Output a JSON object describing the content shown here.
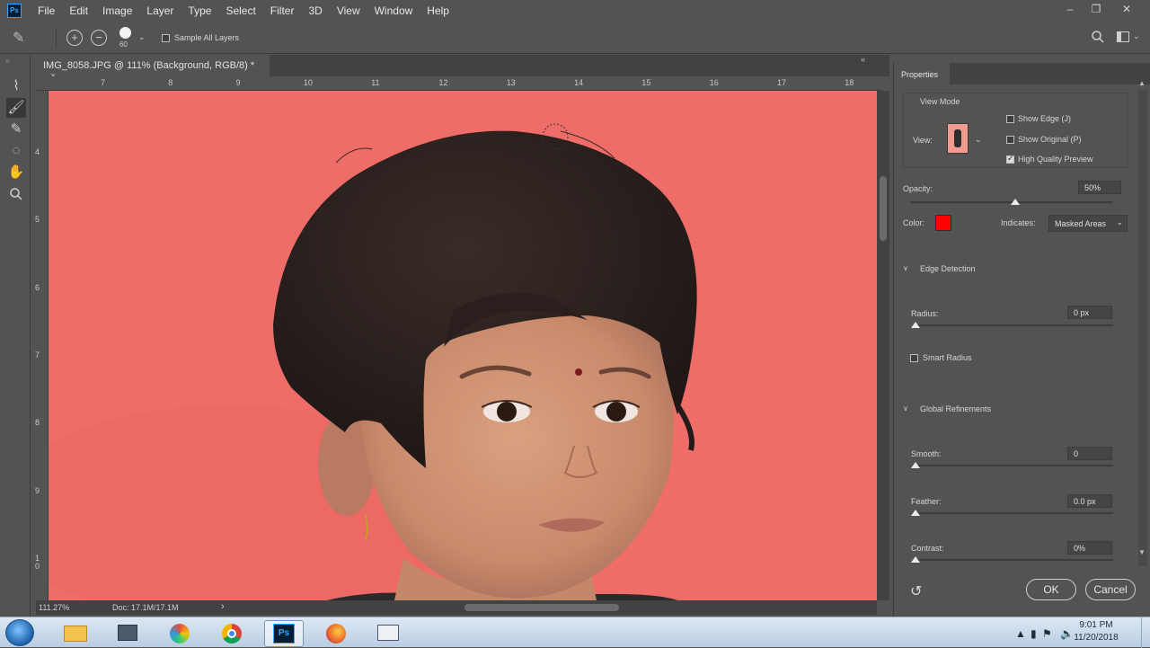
{
  "app": {
    "logo_text": "Ps"
  },
  "menu": [
    "File",
    "Edit",
    "Image",
    "Layer",
    "Type",
    "Select",
    "Filter",
    "3D",
    "View",
    "Window",
    "Help"
  ],
  "options_bar": {
    "brush_size": "60",
    "sample_all_layers_label": "Sample All Layers"
  },
  "document_tab": {
    "title": "IMG_8058.JPG @ 111% (Background, RGB/8) *",
    "close_glyph": "×"
  },
  "ruler": {
    "horizontal": [
      "7",
      "8",
      "9",
      "10",
      "11",
      "12",
      "13",
      "14",
      "15",
      "16",
      "17",
      "18"
    ],
    "vertical": [
      "4",
      "5",
      "6",
      "7",
      "8",
      "9",
      "1\n0"
    ]
  },
  "status_bar": {
    "zoom": "111.27%",
    "doc": "Doc: 17.1M/17.1M",
    "arrow": "›"
  },
  "properties": {
    "tab_label": "Properties",
    "view_mode_label": "View Mode",
    "view_label": "View:",
    "show_edge": {
      "label": "Show Edge (J)",
      "checked": false
    },
    "show_original": {
      "label": "Show Original (P)",
      "checked": false
    },
    "high_quality": {
      "label": "High Quality Preview",
      "checked": true
    },
    "opacity_label": "Opacity:",
    "opacity_value": "50%",
    "opacity_fraction": 0.5,
    "color_label": "Color:",
    "color_value": "#ff0000",
    "indicates_label": "Indicates:",
    "indicates_value": "Masked Areas",
    "edge_detection_label": "Edge Detection",
    "radius_label": "Radius:",
    "radius_value": "0 px",
    "smart_radius": {
      "label": "Smart Radius",
      "checked": false
    },
    "global_refinements_label": "Global Refinements",
    "smooth_label": "Smooth:",
    "smooth_value": "0",
    "feather_label": "Feather:",
    "feather_value": "0.0 px",
    "contrast_label": "Contrast:",
    "contrast_value": "0%",
    "ok_label": "OK",
    "cancel_label": "Cancel"
  },
  "taskbar": {
    "time": "9:01 PM",
    "date": "11/20/2018",
    "apps": [
      "start-orb",
      "file-explorer-icon",
      "computer-icon",
      "paint-icon",
      "chrome-icon",
      "photoshop-icon",
      "firefox-icon",
      "window-icon"
    ]
  },
  "colors": {
    "canvas_background": "#ee6d68",
    "ui_gray": "#535353",
    "accent_blue": "#31a8ff"
  }
}
